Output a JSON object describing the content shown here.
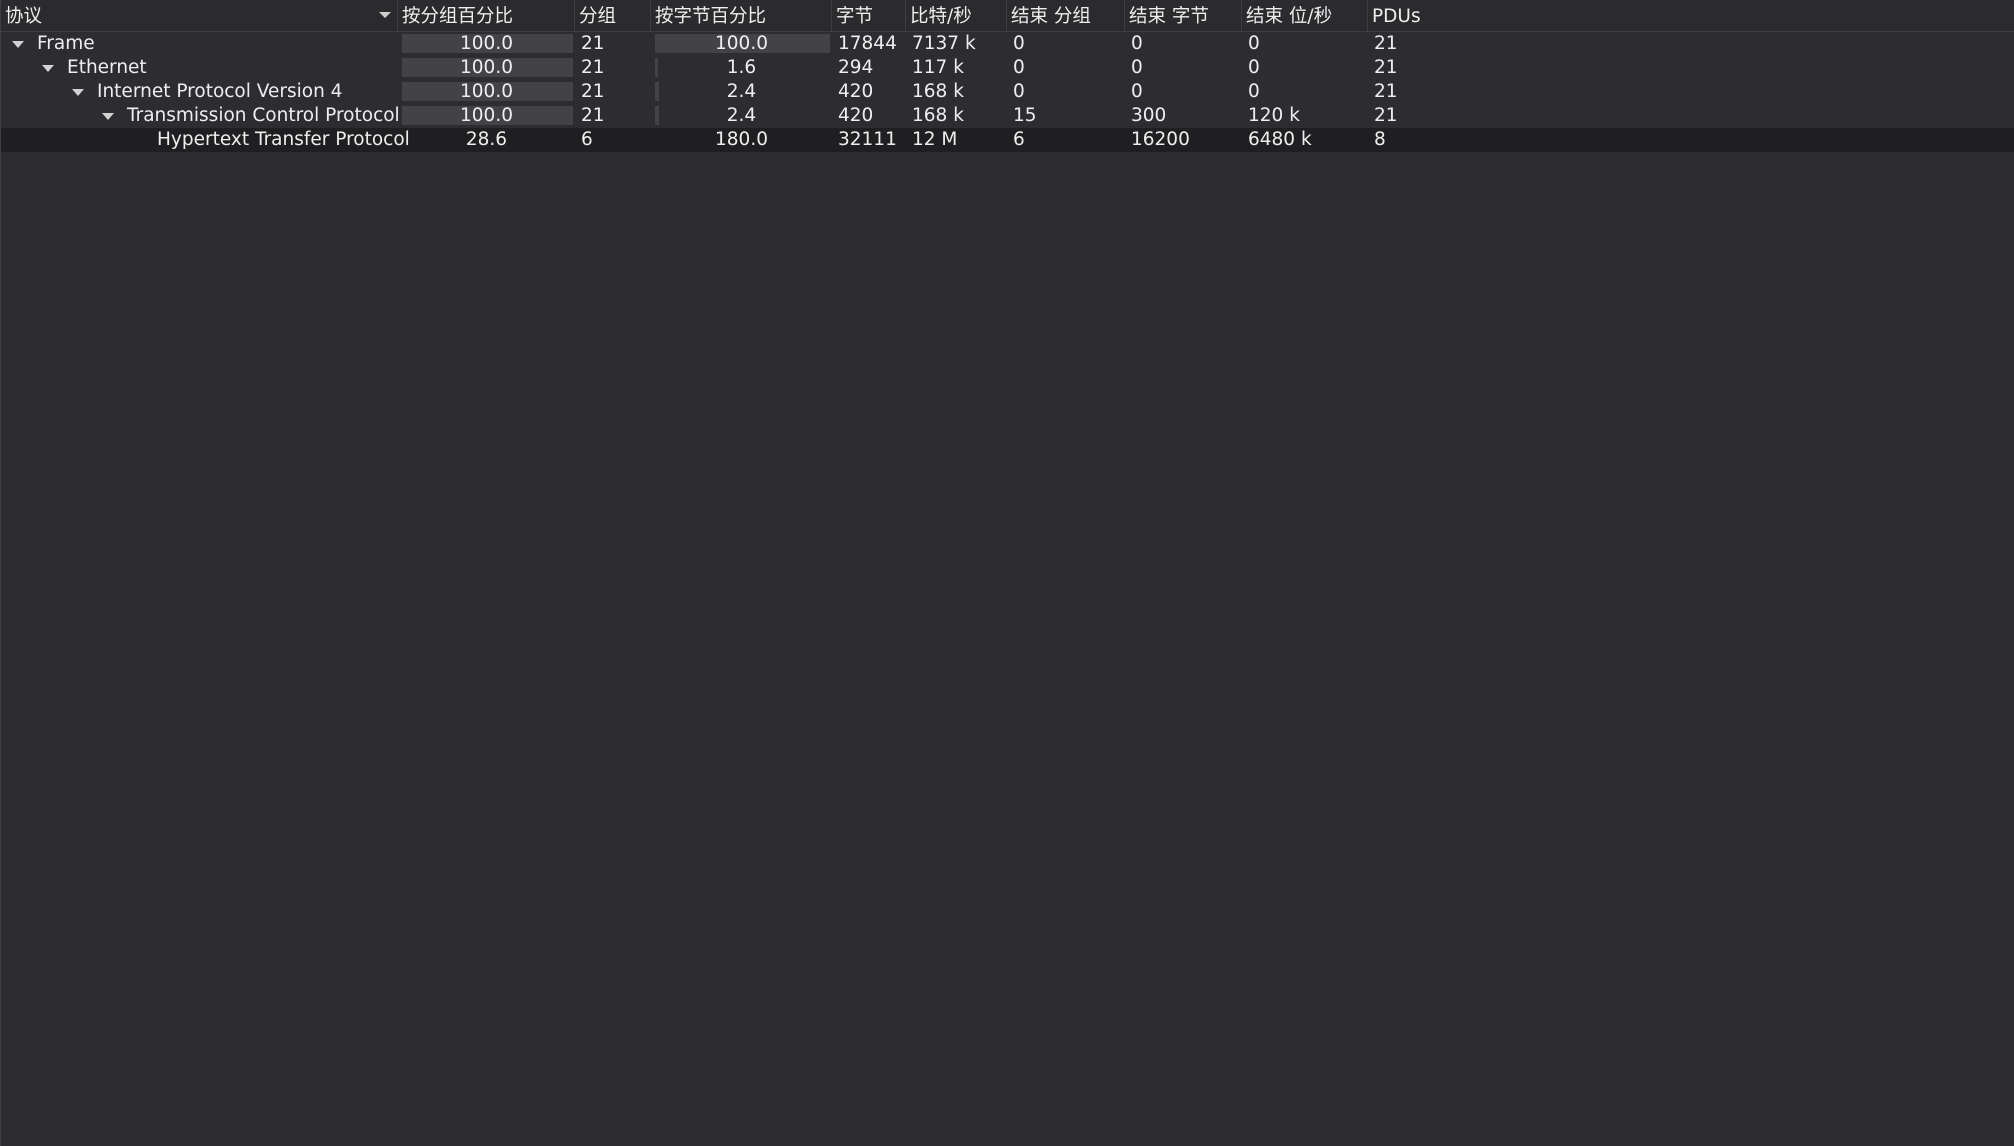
{
  "columns": [
    {
      "key": "protocol",
      "label": "协议"
    },
    {
      "key": "pct_packets",
      "label": "按分组百分比"
    },
    {
      "key": "packets",
      "label": "分组"
    },
    {
      "key": "pct_bytes",
      "label": "按字节百分比"
    },
    {
      "key": "bytes",
      "label": "字节"
    },
    {
      "key": "bps",
      "label": "比特/秒"
    },
    {
      "key": "end_packets",
      "label": "结束 分组"
    },
    {
      "key": "end_bytes",
      "label": "结束 字节"
    },
    {
      "key": "end_bps",
      "label": "结束 位/秒"
    },
    {
      "key": "pdus",
      "label": "PDUs"
    }
  ],
  "rows": [
    {
      "name": "Frame",
      "depth": 0,
      "expanded": true,
      "pct_packets": "100.0",
      "pct_packets_fill": 1.0,
      "packets": "21",
      "pct_bytes": "100.0",
      "pct_bytes_fill": 1.0,
      "bytes": "17844",
      "bps": "7137 k",
      "end_packets": "0",
      "end_bytes": "0",
      "end_bps": "0",
      "pdus": "21"
    },
    {
      "name": "Ethernet",
      "depth": 1,
      "expanded": true,
      "pct_packets": "100.0",
      "pct_packets_fill": 1.0,
      "packets": "21",
      "pct_bytes": "1.6",
      "pct_bytes_fill": 0.016,
      "bytes": "294",
      "bps": "117 k",
      "end_packets": "0",
      "end_bytes": "0",
      "end_bps": "0",
      "pdus": "21"
    },
    {
      "name": "Internet Protocol Version 4",
      "depth": 2,
      "expanded": true,
      "pct_packets": "100.0",
      "pct_packets_fill": 1.0,
      "packets": "21",
      "pct_bytes": "2.4",
      "pct_bytes_fill": 0.024,
      "bytes": "420",
      "bps": "168 k",
      "end_packets": "0",
      "end_bytes": "0",
      "end_bps": "0",
      "pdus": "21"
    },
    {
      "name": "Transmission Control Protocol",
      "depth": 3,
      "expanded": true,
      "pct_packets": "100.0",
      "pct_packets_fill": 1.0,
      "packets": "21",
      "pct_bytes": "2.4",
      "pct_bytes_fill": 0.024,
      "bytes": "420",
      "bps": "168 k",
      "end_packets": "15",
      "end_bytes": "300",
      "end_bps": "120 k",
      "pdus": "21"
    },
    {
      "name": "Hypertext Transfer Protocol",
      "depth": 4,
      "expanded": false,
      "selected": true,
      "pct_packets": "28.6",
      "pct_packets_fill": 0.0,
      "packets": "6",
      "pct_bytes": "180.0",
      "pct_bytes_fill": 0.0,
      "bytes": "32111",
      "bps": "12 M",
      "end_packets": "6",
      "end_bytes": "16200",
      "end_bps": "6480 k",
      "pdus": "8"
    }
  ],
  "colors": {
    "background": "#2d2c30",
    "header": "#2b2b2e",
    "bar": "#434247",
    "selected_row": "#1f1f22",
    "text": "#eeeeee"
  },
  "icons": {
    "sort": "chevron-down-icon",
    "expander": "expand-triangle-icon"
  }
}
